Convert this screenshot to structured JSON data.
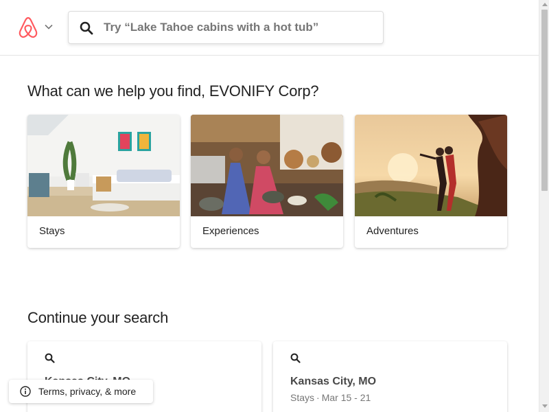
{
  "header": {
    "logo": "airbnb-logo",
    "search": {
      "placeholder": "Try “Lake Tahoe cabins with a hot tub”",
      "value": ""
    }
  },
  "main": {
    "greeting": "What can we help you find, EVONIFY Corp?",
    "categories": [
      {
        "label": "Stays",
        "image": "bedroom-photo"
      },
      {
        "label": "Experiences",
        "image": "cooking-class-photo"
      },
      {
        "label": "Adventures",
        "image": "mountain-sunset-photo"
      }
    ],
    "continue_title": "Continue your search",
    "recent_searches": [
      {
        "title": "Kansas City, MO",
        "subtitle": "",
        "icon": "search-icon"
      },
      {
        "title": "Kansas City, MO",
        "type": "Stays",
        "dates": "Mar 15 - 21",
        "icon": "search-icon"
      }
    ]
  },
  "footer_pill": {
    "label": "Terms, privacy, & more",
    "icon": "info-icon"
  },
  "colors": {
    "brand": "#FF5A5F",
    "text": "#222222",
    "muted": "#767676"
  }
}
